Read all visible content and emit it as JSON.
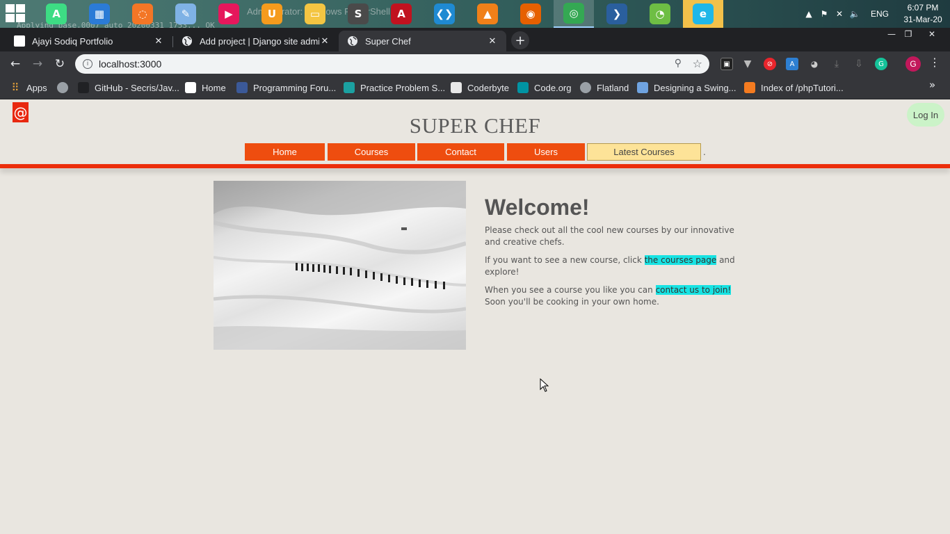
{
  "taskbar": {
    "ghost_console_text": "Applying base.0007_auto_20200331_1753... OK",
    "ghost_window_text": "Administrator: Windows PowerShell",
    "apps": [
      {
        "name": "android-studio-icon",
        "color": "#3ddc84",
        "glyph": "A"
      },
      {
        "name": "control-panel-icon",
        "color": "#2b7bd6",
        "glyph": "▦"
      },
      {
        "name": "jupyter-icon",
        "color": "#f37626",
        "glyph": "◌"
      },
      {
        "name": "notepad-icon",
        "color": "#7fb2e5",
        "glyph": "✎"
      },
      {
        "name": "media-player-icon",
        "color": "#e6175c",
        "glyph": "▶"
      },
      {
        "name": "uc-browser-icon",
        "color": "#f59b1d",
        "glyph": "U"
      },
      {
        "name": "file-explorer-icon",
        "color": "#f4c542",
        "glyph": "▭"
      },
      {
        "name": "sublime-text-icon",
        "color": "#4a4a4a",
        "glyph": "S"
      },
      {
        "name": "acrobat-icon",
        "color": "#c1121f",
        "glyph": "A"
      },
      {
        "name": "vscode-icon",
        "color": "#1f8ad2",
        "glyph": "❮❯"
      },
      {
        "name": "vlc-icon",
        "color": "#f08019",
        "glyph": "▲"
      },
      {
        "name": "firefox-icon",
        "color": "#e66000",
        "glyph": "◉"
      },
      {
        "name": "chrome-icon",
        "color": "#34a853",
        "glyph": "◎"
      },
      {
        "name": "powershell-icon",
        "color": "#2a5f9e",
        "glyph": "❯"
      },
      {
        "name": "etisalat-icon",
        "color": "#6ebe44",
        "glyph": "◔"
      },
      {
        "name": "edge-icon",
        "color": "#1fb7e8",
        "glyph": "e"
      }
    ],
    "lang": "ENG",
    "time": "6:07 PM",
    "date": "31-Mar-20"
  },
  "tabs": [
    {
      "title": "Ajayi Sodiq Portfolio",
      "icon": "page-icon"
    },
    {
      "title": "Add project | Django site admin",
      "icon": "globe-icon"
    },
    {
      "title": "Super Chef",
      "icon": "globe-icon",
      "active": true
    }
  ],
  "address_bar": {
    "url": "localhost:3000"
  },
  "bookmarks": [
    {
      "label": "Apps",
      "icon": "apps-grid-icon",
      "color": "#e8a33b"
    },
    {
      "label": "",
      "icon": "globe-icon",
      "color": "#9aa0a6"
    },
    {
      "label": "GitHub - Secris/Jav...",
      "icon": "github-icon",
      "color": "#202124"
    },
    {
      "label": "Home",
      "icon": "page-icon",
      "color": "#ffffff"
    },
    {
      "label": "Programming Foru...",
      "icon": "forum-icon",
      "color": "#3b5998"
    },
    {
      "label": "Practice Problem S...",
      "icon": "practice-icon",
      "color": "#1ba1a1"
    },
    {
      "label": "Coderbyte",
      "icon": "coderbyte-icon",
      "color": "#e8e8e8"
    },
    {
      "label": "Code.org",
      "icon": "code-org-icon",
      "color": "#0094a3"
    },
    {
      "label": "Flatland",
      "icon": "globe-icon",
      "color": "#9aa0a6"
    },
    {
      "label": "Designing a Swing...",
      "icon": "cube-icon",
      "color": "#6fa3e0"
    },
    {
      "label": "Index of /phpTutori...",
      "icon": "xampp-icon",
      "color": "#f47b20"
    }
  ],
  "site": {
    "logo_glyph": "@",
    "login_label": "Log In",
    "title": "SUPER CHEF",
    "nav": [
      "Home",
      "Courses",
      "Contact",
      "Users",
      "Latest Courses"
    ],
    "nav_trailing": ".",
    "welcome_heading": "Welcome!",
    "para1": "Please check out all the cool new courses by our innovative and creative chefs.",
    "para2_before": "If you want to see a new course, click ",
    "para2_link": "the courses page",
    "para2_after": " and explore!",
    "para3_before": "When you see a course you like you can ",
    "para3_link": "contact us to join!",
    "para3_after": " Soon you'll be cooking in your own home."
  }
}
